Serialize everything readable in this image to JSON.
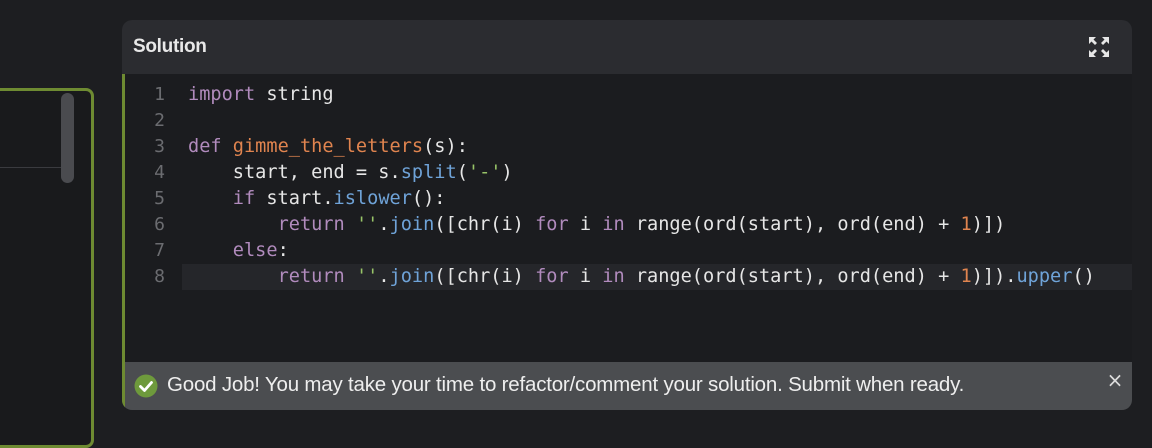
{
  "panel": {
    "title": "Solution"
  },
  "editor": {
    "active_line": 8,
    "lines": [
      {
        "number": "1",
        "tokens": [
          {
            "t": "import",
            "c": "kw"
          },
          {
            "t": " string",
            "c": ""
          }
        ]
      },
      {
        "number": "2",
        "tokens": []
      },
      {
        "number": "3",
        "tokens": [
          {
            "t": "def",
            "c": "kw"
          },
          {
            "t": " ",
            "c": ""
          },
          {
            "t": "gimme_the_letters",
            "c": "fn"
          },
          {
            "t": "(s):",
            "c": ""
          }
        ]
      },
      {
        "number": "4",
        "tokens": [
          {
            "t": "    start, end = s.",
            "c": ""
          },
          {
            "t": "split",
            "c": "meth"
          },
          {
            "t": "(",
            "c": ""
          },
          {
            "t": "'-'",
            "c": "str"
          },
          {
            "t": ")",
            "c": ""
          }
        ]
      },
      {
        "number": "5",
        "tokens": [
          {
            "t": "    ",
            "c": ""
          },
          {
            "t": "if",
            "c": "kw"
          },
          {
            "t": " start.",
            "c": ""
          },
          {
            "t": "islower",
            "c": "meth"
          },
          {
            "t": "():",
            "c": ""
          }
        ]
      },
      {
        "number": "6",
        "tokens": [
          {
            "t": "        ",
            "c": ""
          },
          {
            "t": "return",
            "c": "kw"
          },
          {
            "t": " ",
            "c": ""
          },
          {
            "t": "''",
            "c": "str"
          },
          {
            "t": ".",
            "c": ""
          },
          {
            "t": "join",
            "c": "meth"
          },
          {
            "t": "([chr(i) ",
            "c": ""
          },
          {
            "t": "for",
            "c": "kw"
          },
          {
            "t": " i ",
            "c": ""
          },
          {
            "t": "in",
            "c": "kw"
          },
          {
            "t": " range(ord(start), ord(end) + ",
            "c": ""
          },
          {
            "t": "1",
            "c": "num"
          },
          {
            "t": ")])",
            "c": ""
          }
        ]
      },
      {
        "number": "7",
        "tokens": [
          {
            "t": "    ",
            "c": ""
          },
          {
            "t": "else",
            "c": "kw"
          },
          {
            "t": ":",
            "c": ""
          }
        ]
      },
      {
        "number": "8",
        "tokens": [
          {
            "t": "        ",
            "c": ""
          },
          {
            "t": "return",
            "c": "kw"
          },
          {
            "t": " ",
            "c": ""
          },
          {
            "t": "''",
            "c": "str"
          },
          {
            "t": ".",
            "c": ""
          },
          {
            "t": "join",
            "c": "meth"
          },
          {
            "t": "([chr(i) ",
            "c": ""
          },
          {
            "t": "for",
            "c": "kw"
          },
          {
            "t": " i ",
            "c": ""
          },
          {
            "t": "in",
            "c": "kw"
          },
          {
            "t": " range(ord(start), ord(end) + ",
            "c": ""
          },
          {
            "t": "1",
            "c": "num"
          },
          {
            "t": ")]).",
            "c": ""
          },
          {
            "t": "upper",
            "c": "meth"
          },
          {
            "t": "()",
            "c": ""
          }
        ]
      }
    ]
  },
  "notification": {
    "message": "Good Job! You may take your time to refactor/comment your solution. Submit when ready.",
    "close_symbol": "×"
  },
  "colors": {
    "accent": "#6e8b32",
    "success": "#6e9a3c"
  }
}
